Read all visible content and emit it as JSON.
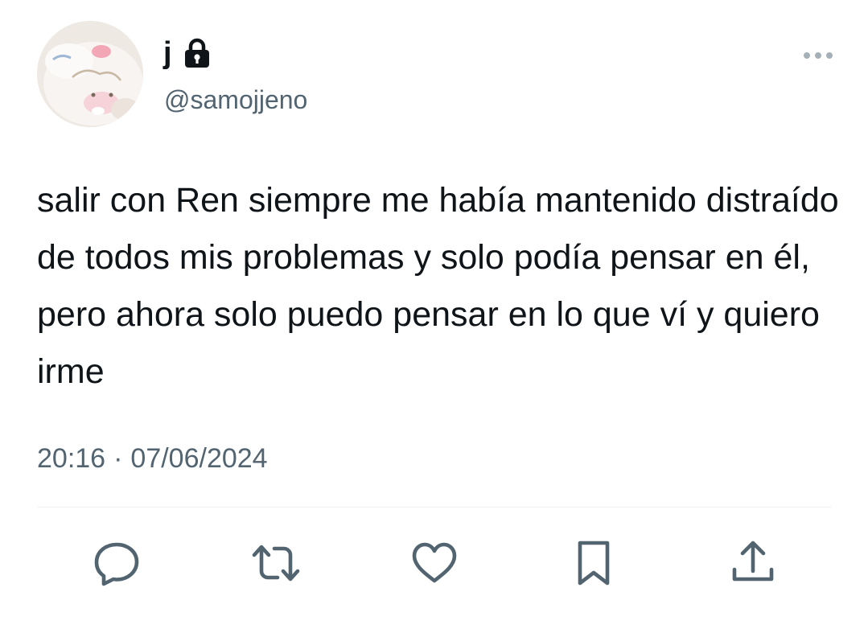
{
  "author": {
    "display_name": "j",
    "handle": "@samojjeno",
    "protected": true,
    "avatar_icon": "plush-toy-avatar"
  },
  "tweet": {
    "text": "salir con Ren siempre me había mantenido distraído de todos mis problemas y solo podía pensar en él, pero ahora solo puedo pensar en lo que ví y quiero irme",
    "time": "20:16",
    "separator": "·",
    "date": "07/06/2024"
  },
  "actions": [
    {
      "name": "reply",
      "icon": "comment-icon"
    },
    {
      "name": "retweet",
      "icon": "retweet-icon"
    },
    {
      "name": "like",
      "icon": "heart-icon"
    },
    {
      "name": "bookmark",
      "icon": "bookmark-icon"
    },
    {
      "name": "share",
      "icon": "share-icon"
    }
  ],
  "colors": {
    "text": "#0f1419",
    "secondary": "#536471",
    "divider": "#eff3f4"
  }
}
